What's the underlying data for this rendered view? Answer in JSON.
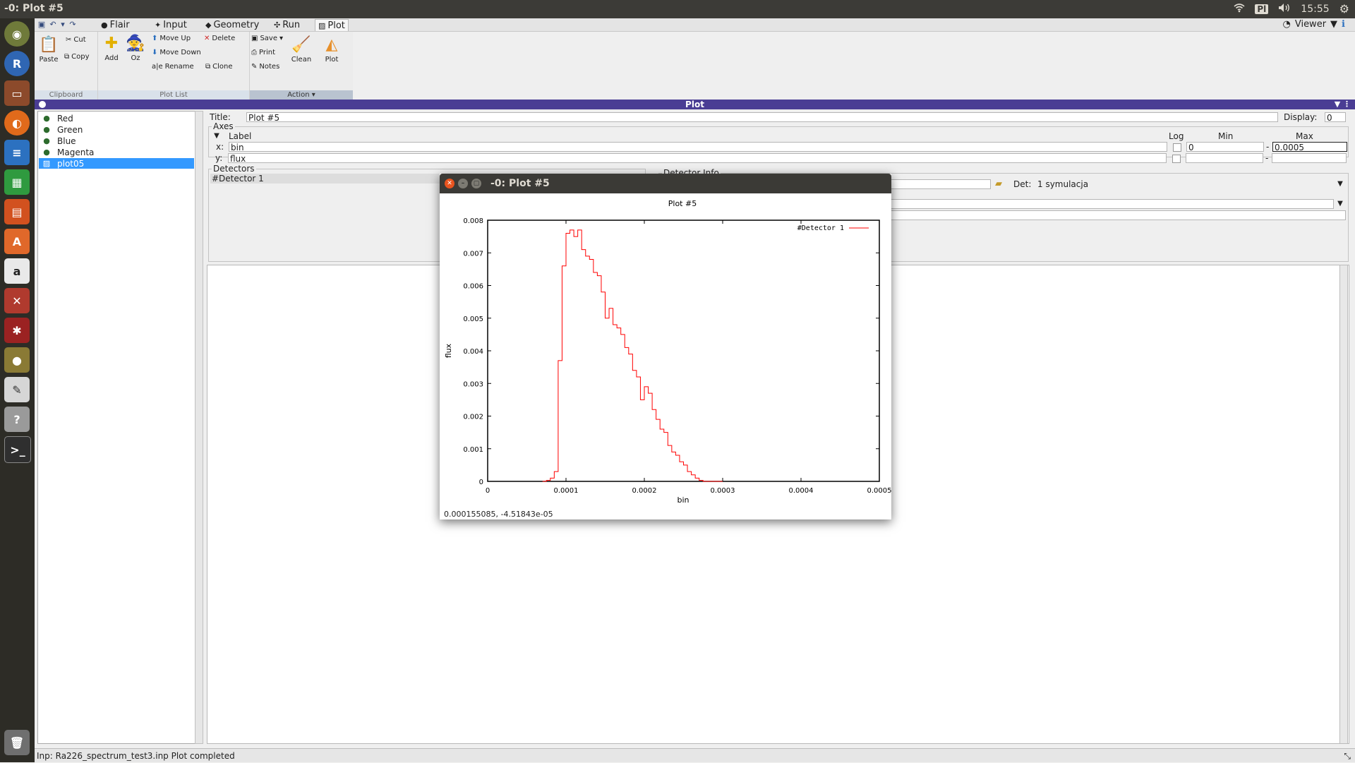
{
  "system": {
    "window_title": "-0: Plot #5",
    "keyboard_layout": "Pl",
    "clock": "15:55"
  },
  "launcher": {
    "items": [
      "ubuntu-dash",
      "r-app",
      "files",
      "firefox",
      "writer",
      "calc",
      "impress",
      "software-center",
      "amazon",
      "system-settings",
      "network-tool",
      "flair-app",
      "text-editor",
      "help",
      "terminal",
      "trash"
    ]
  },
  "toolbar": {
    "tabs": [
      {
        "label": "Flair",
        "icon": "cauldron-icon"
      },
      {
        "label": "Input",
        "icon": "input-icon"
      },
      {
        "label": "Geometry",
        "icon": "geometry-icon"
      },
      {
        "label": "Run",
        "icon": "run-icon"
      },
      {
        "label": "Plot",
        "icon": "plot-icon"
      }
    ],
    "viewer_label": "Viewer"
  },
  "ribbon": {
    "clipboard": {
      "paste": "Paste",
      "cut": "Cut",
      "copy": "Copy",
      "label": "Clipboard"
    },
    "plotlist": {
      "add": "Add",
      "oz": "Oz",
      "move_up": "Move Up",
      "move_down": "Move Down",
      "rename": "Rename",
      "delete": "Delete",
      "clone": "Clone",
      "label": "Plot List"
    },
    "action": {
      "save": "Save",
      "print": "Print",
      "notes": "Notes",
      "clean": "Clean",
      "plot": "Plot",
      "label": "Action"
    }
  },
  "panel": {
    "header": "Plot",
    "plots": [
      {
        "name": "Red",
        "selected": false
      },
      {
        "name": "Green",
        "selected": false
      },
      {
        "name": "Blue",
        "selected": false
      },
      {
        "name": "Magenta",
        "selected": false
      },
      {
        "name": "plot05",
        "selected": true
      }
    ],
    "title_label": "Title:",
    "title_value": "Plot #5",
    "display_label": "Display:",
    "display_value": "0",
    "axes": {
      "legend": "Axes",
      "col_label": "Label",
      "col_log": "Log",
      "col_min": "Min",
      "col_max": "Max",
      "x": {
        "axis": "x:",
        "label": "bin",
        "min": "0",
        "max": "0.0005"
      },
      "y": {
        "axis": "y:",
        "label": "flux",
        "min": "",
        "max": ""
      }
    },
    "detectors_legend": "Detectors",
    "detectors": [
      "#Detector 1"
    ],
    "detector_info_legend": "Detector Info",
    "det_label": "Det:",
    "det_value": "1 symulacja"
  },
  "status_bar": {
    "text": "Inp: Ra226_spectrum_test3.inp  Plot completed"
  },
  "plot_window": {
    "title": "-0: Plot #5",
    "coords": "0.000155085, -4.51843e-05"
  },
  "chart_data": {
    "type": "line",
    "title": "Plot #5",
    "xlabel": "bin",
    "ylabel": "flux",
    "xlim": [
      0,
      0.0005
    ],
    "ylim": [
      0,
      0.008
    ],
    "x_ticks": [
      "0",
      "0.0001",
      "0.0002",
      "0.0003",
      "0.0004",
      "0.0005"
    ],
    "y_ticks": [
      "0",
      "0.001",
      "0.002",
      "0.003",
      "0.004",
      "0.005",
      "0.006",
      "0.007",
      "0.008"
    ],
    "legend_position": "top-right",
    "series": [
      {
        "name": "#Detector 1",
        "color": "#ff0000",
        "step": true,
        "x": [
          7e-05,
          7.5e-05,
          8e-05,
          8.5e-05,
          9e-05,
          9.5e-05,
          0.0001,
          0.000105,
          0.00011,
          0.000115,
          0.00012,
          0.000125,
          0.00013,
          0.000135,
          0.00014,
          0.000145,
          0.00015,
          0.000155,
          0.00016,
          0.000165,
          0.00017,
          0.000175,
          0.00018,
          0.000185,
          0.00019,
          0.000195,
          0.0002,
          0.000205,
          0.00021,
          0.000215,
          0.00022,
          0.000225,
          0.00023,
          0.000235,
          0.00024,
          0.000245,
          0.00025,
          0.000255,
          0.00026,
          0.000265,
          0.00027,
          0.000275,
          0.00028,
          0.000285,
          0.00029,
          0.000295,
          0.0003
        ],
        "y": [
          0,
          3e-05,
          0.0001,
          0.0003,
          0.0037,
          0.0066,
          0.0076,
          0.0077,
          0.0075,
          0.0077,
          0.0071,
          0.0069,
          0.0068,
          0.0064,
          0.0063,
          0.0058,
          0.005,
          0.0053,
          0.0048,
          0.0047,
          0.0045,
          0.0041,
          0.0039,
          0.0034,
          0.0032,
          0.0025,
          0.0029,
          0.0027,
          0.0022,
          0.0019,
          0.0016,
          0.0015,
          0.0011,
          0.0009,
          0.0008,
          0.0006,
          0.0005,
          0.0003,
          0.0002,
          0.0001,
          3e-05,
          0,
          0,
          0,
          0,
          0,
          0
        ]
      }
    ]
  }
}
